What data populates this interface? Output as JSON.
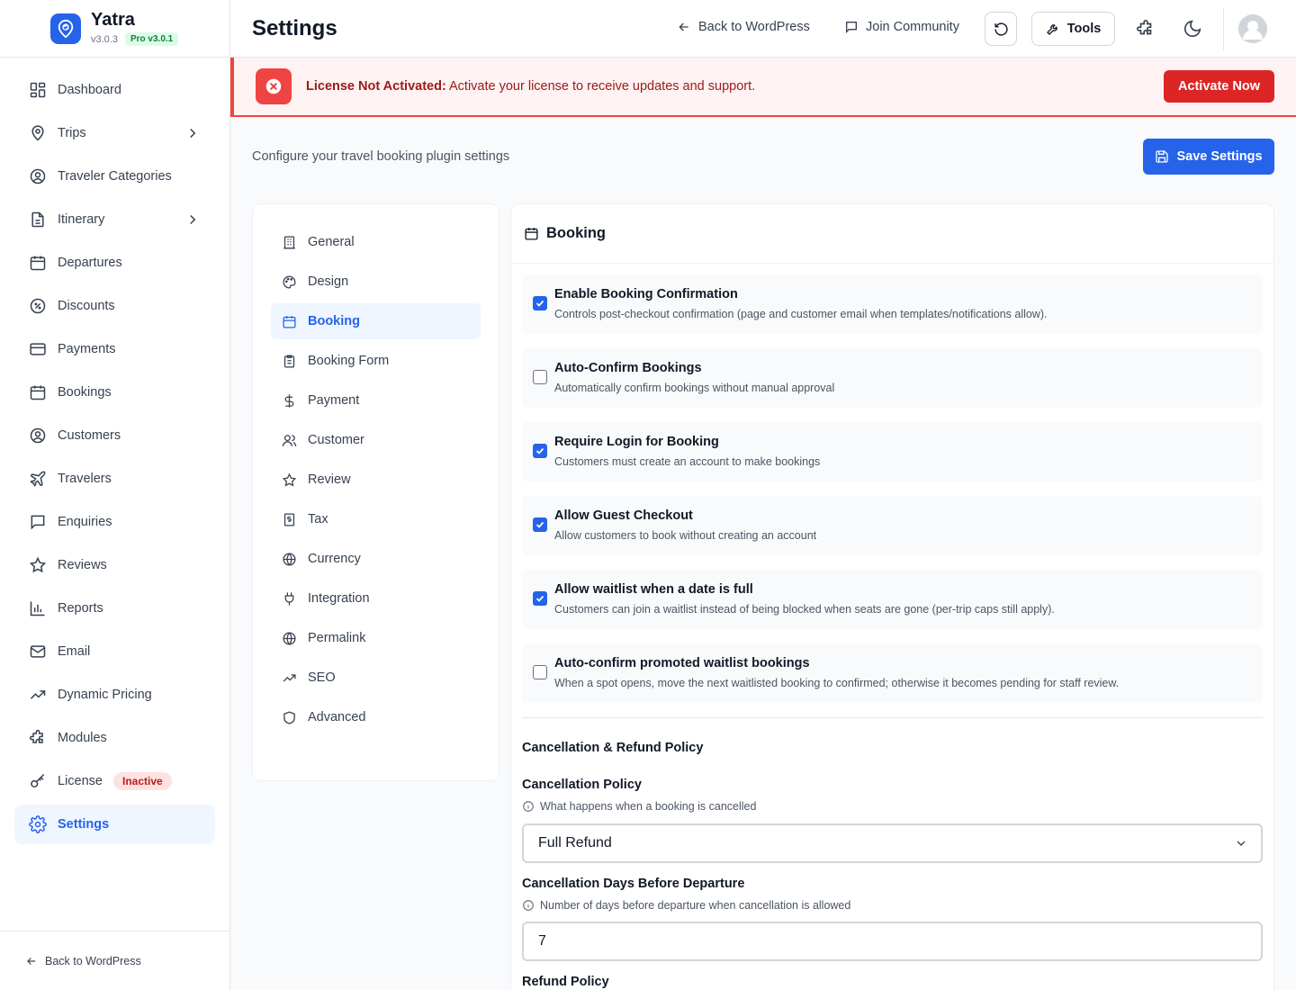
{
  "brand": {
    "name": "Yatra",
    "version": "v3.0.3",
    "pro": "Pro v3.0.1"
  },
  "sidebar": {
    "items": [
      {
        "label": "Dashboard"
      },
      {
        "label": "Trips"
      },
      {
        "label": "Traveler Categories"
      },
      {
        "label": "Itinerary"
      },
      {
        "label": "Departures"
      },
      {
        "label": "Discounts"
      },
      {
        "label": "Payments"
      },
      {
        "label": "Bookings"
      },
      {
        "label": "Customers"
      },
      {
        "label": "Travelers"
      },
      {
        "label": "Enquiries"
      },
      {
        "label": "Reviews"
      },
      {
        "label": "Reports"
      },
      {
        "label": "Email"
      },
      {
        "label": "Dynamic Pricing"
      },
      {
        "label": "Modules"
      },
      {
        "label": "License",
        "badge": "Inactive"
      },
      {
        "label": "Settings"
      }
    ],
    "footer": "Back to WordPress"
  },
  "header": {
    "title": "Settings",
    "back": "Back to WordPress",
    "community": "Join Community",
    "tools": "Tools"
  },
  "banner": {
    "strong": "License Not Activated:",
    "text": " Activate your license to receive updates and support.",
    "button": "Activate Now"
  },
  "content": {
    "subtitle": "Configure your travel booking plugin settings",
    "save": "Save Settings"
  },
  "settings_nav": [
    "General",
    "Design",
    "Booking",
    "Booking Form",
    "Payment",
    "Customer",
    "Review",
    "Tax",
    "Currency",
    "Integration",
    "Permalink",
    "SEO",
    "Advanced"
  ],
  "panel": {
    "title": "Booking",
    "options": [
      {
        "title": "Enable Booking Confirmation",
        "desc": "Controls post-checkout confirmation (page and customer email when templates/notifications allow).",
        "checked": true
      },
      {
        "title": "Auto-Confirm Bookings",
        "desc": "Automatically confirm bookings without manual approval",
        "checked": false
      },
      {
        "title": "Require Login for Booking",
        "desc": "Customers must create an account to make bookings",
        "checked": true
      },
      {
        "title": "Allow Guest Checkout",
        "desc": "Allow customers to book without creating an account",
        "checked": true
      },
      {
        "title": "Allow waitlist when a date is full",
        "desc": "Customers can join a waitlist instead of being blocked when seats are gone (per-trip caps still apply).",
        "checked": true
      },
      {
        "title": "Auto-confirm promoted waitlist bookings",
        "desc": "When a spot opens, move the next waitlisted booking to confirmed; otherwise it becomes pending for staff review.",
        "checked": false
      }
    ],
    "section": "Cancellation & Refund Policy",
    "cancel_policy": {
      "label": "Cancellation Policy",
      "help": "What happens when a booking is cancelled",
      "value": "Full Refund"
    },
    "cancel_days": {
      "label": "Cancellation Days Before Departure",
      "help": "Number of days before departure when cancellation is allowed",
      "value": "7"
    },
    "refund_policy": {
      "label": "Refund Policy"
    }
  },
  "colors": {
    "accent": "#2563eb",
    "danger": "#dc2626",
    "pro": "#15803d"
  }
}
